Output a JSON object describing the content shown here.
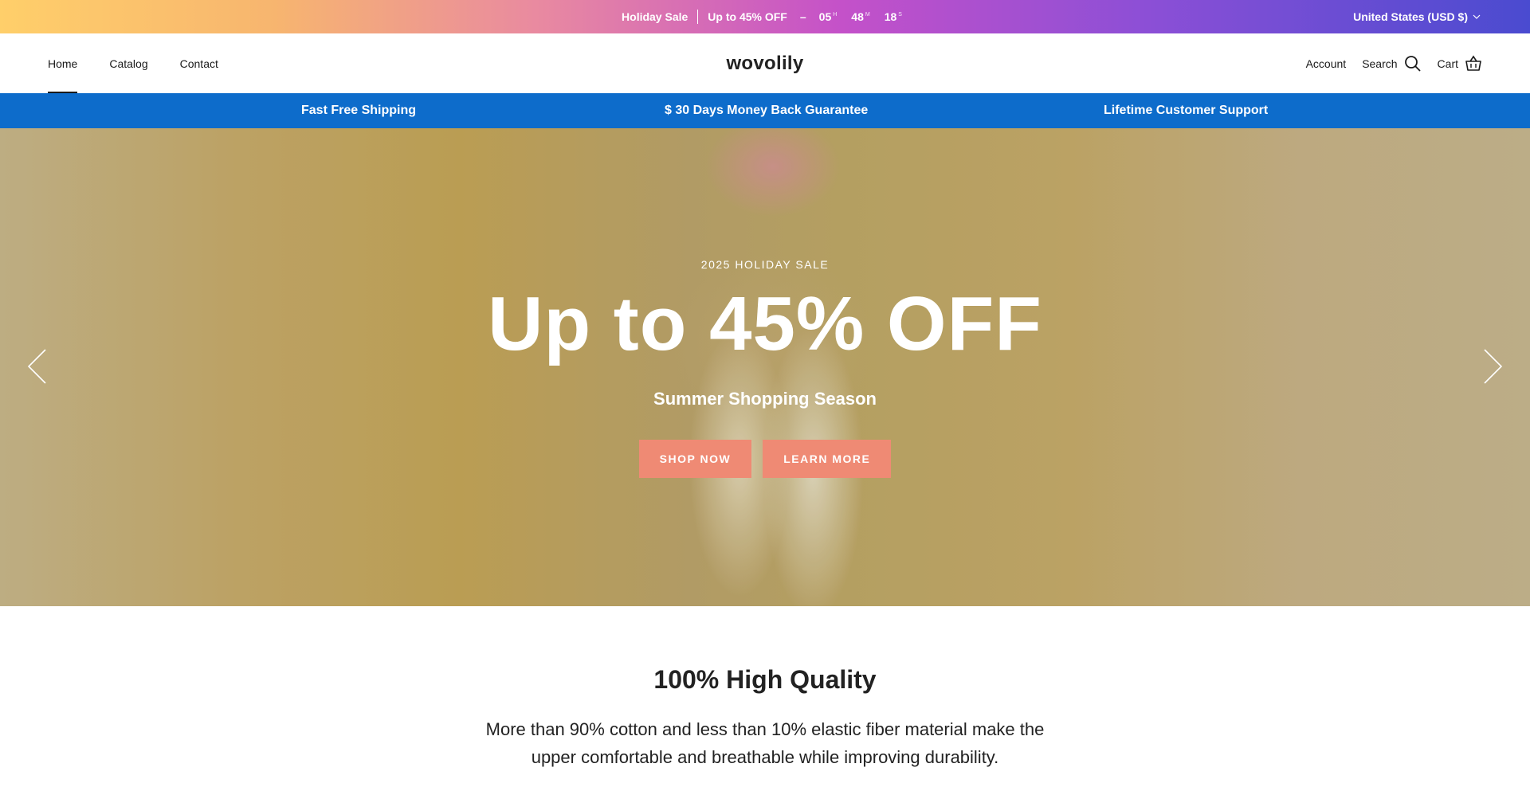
{
  "announcement": {
    "text": "Holiday Sale",
    "offer": "Up to 45% OFF",
    "dash": "–",
    "countdown": [
      {
        "value": "05",
        "unit": "H"
      },
      {
        "value": "48",
        "unit": "M"
      },
      {
        "value": "18",
        "unit": "S"
      }
    ],
    "currency": "United States (USD $)"
  },
  "header": {
    "nav": [
      {
        "label": "Home",
        "active": true
      },
      {
        "label": "Catalog",
        "active": false
      },
      {
        "label": "Contact",
        "active": false
      }
    ],
    "logo": "wovolily",
    "account_label": "Account",
    "search_label": "Search",
    "cart_label": "Cart"
  },
  "benefits": [
    "Fast Free Shipping",
    "$ 30 Days Money Back Guarantee",
    "Lifetime Customer Support"
  ],
  "hero": {
    "eyebrow": "2025 HOLIDAY SALE",
    "headline": "Up to 45% OFF",
    "subtitle": "Summer Shopping Season",
    "primary_button": "SHOP NOW",
    "secondary_button": "LEARN MORE"
  },
  "quality": {
    "title": "100% High Quality",
    "body": "More than 90% cotton and less than 10% elastic fiber material make the upper comfortable and breathable while improving durability."
  },
  "colors": {
    "benefit_bar": "#0d6ccb",
    "button": "#ef8a74"
  }
}
